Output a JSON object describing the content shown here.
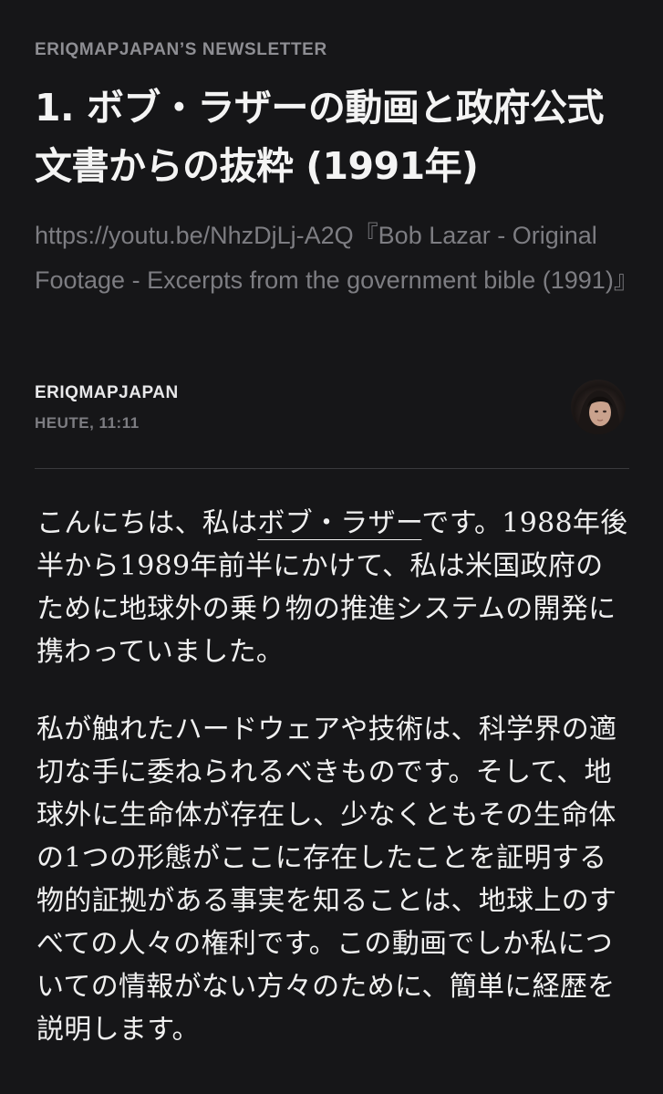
{
  "header": {
    "publication": "ERIQMAPJAPAN’S NEWSLETTER"
  },
  "post": {
    "title": "1. ボブ・ラザーの動画と政府公式文書からの抜粋 (1991年)",
    "subtitle": "https://youtu.be/NhzDjLj-A2Q『Bob Lazar - Original Footage - Excerpts from the government bible (1991)』",
    "author": "ERIQMAPJAPAN",
    "date": "HEUTE, 11:11"
  },
  "body": {
    "p1_before": "こんにちは、私は",
    "p1_link": "ボブ・ラザー",
    "p1_after": "です。1988年後半から1989年前半にかけて、私は米国政府のために地球外の乗り物の推進システムの開発に携わっていました。",
    "p2": "私が触れたハードウェアや技術は、科学界の適切な手に委ねられるべきものです。そして、地球外に生命体が存在し、少なくともその生命体の1つの形態がここに存在したことを証明する物的証拠がある事実を知ることは、地球上のすべての人々の権利です。この動画でしか私についての情報がない方々のために、簡単に経歴を説明します。"
  }
}
